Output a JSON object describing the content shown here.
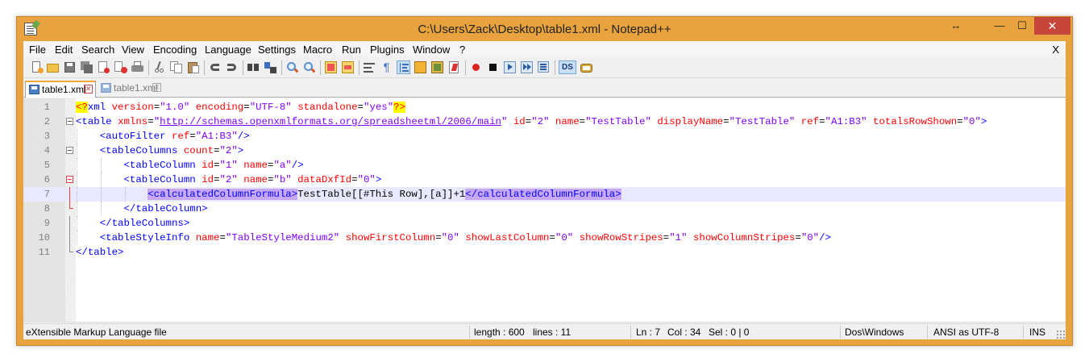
{
  "window": {
    "title": "C:\\Users\\Zack\\Desktop\\table1.xml - Notepad++",
    "resize_glyph": "↔",
    "minimize_glyph": "—",
    "maximize_glyph": "☐",
    "close_glyph": "✕"
  },
  "menu": {
    "items": [
      "File",
      "Edit",
      "Search",
      "View",
      "Encoding",
      "Language",
      "Settings",
      "Macro",
      "Run",
      "Plugins",
      "Window",
      "?"
    ],
    "close_label": "X"
  },
  "toolbar": {
    "icons": [
      "new-file-icon",
      "open-file-icon",
      "save-icon",
      "save-all-icon",
      "close-icon",
      "close-all-icon",
      "print-icon",
      "cut-icon",
      "copy-icon",
      "paste-icon",
      "undo-icon",
      "redo-icon",
      "find-icon",
      "replace-icon",
      "zoom-in-icon",
      "zoom-out-icon",
      "sync-vertical-icon",
      "sync-horizontal-icon",
      "word-wrap-icon",
      "show-all-chars-icon",
      "indent-guide-icon",
      "user-language-icon",
      "function-list-icon",
      "record-macro-icon",
      "stop-record-icon",
      "play-macro-icon",
      "run-macro-multiple-icon",
      "save-macro-icon",
      "document-switcher-icon",
      "plugin-icon"
    ],
    "ds_label": "DS"
  },
  "tabs": [
    {
      "label": "table1.xml",
      "active": true
    },
    {
      "label": "table1.xml",
      "active": false
    }
  ],
  "editor": {
    "current_line": 7,
    "lines": [
      {
        "n": "1",
        "parts": [
          [
            "pi",
            "<?"
          ],
          [
            "tag",
            "xml "
          ],
          [
            "attr",
            "version"
          ],
          [
            "text",
            "="
          ],
          [
            "val",
            "\"1.0\""
          ],
          [
            "text",
            " "
          ],
          [
            "attr",
            "encoding"
          ],
          [
            "text",
            "="
          ],
          [
            "val",
            "\"UTF-8\""
          ],
          [
            "text",
            " "
          ],
          [
            "attr",
            "standalone"
          ],
          [
            "text",
            "="
          ],
          [
            "val",
            "\"yes\""
          ],
          [
            "pi",
            "?>"
          ]
        ]
      },
      {
        "n": "2",
        "parts": [
          [
            "tag",
            "<table "
          ],
          [
            "attr",
            "xmlns"
          ],
          [
            "text",
            "="
          ],
          [
            "val",
            "\""
          ],
          [
            "link",
            "http://schemas.openxmlformats.org/spreadsheetml/2006/main"
          ],
          [
            "val",
            "\""
          ],
          [
            "text",
            " "
          ],
          [
            "attr",
            "id"
          ],
          [
            "text",
            "="
          ],
          [
            "val",
            "\"2\""
          ],
          [
            "text",
            " "
          ],
          [
            "attr",
            "name"
          ],
          [
            "text",
            "="
          ],
          [
            "val",
            "\"TestTable\""
          ],
          [
            "text",
            " "
          ],
          [
            "attr",
            "displayName"
          ],
          [
            "text",
            "="
          ],
          [
            "val",
            "\"TestTable\""
          ],
          [
            "text",
            " "
          ],
          [
            "attr",
            "ref"
          ],
          [
            "text",
            "="
          ],
          [
            "val",
            "\"A1:B3\""
          ],
          [
            "text",
            " "
          ],
          [
            "attr",
            "totalsRowShown"
          ],
          [
            "text",
            "="
          ],
          [
            "val",
            "\"0\""
          ],
          [
            "tag",
            ">"
          ]
        ]
      },
      {
        "n": "3",
        "parts": [
          [
            "text",
            "    "
          ],
          [
            "tag",
            "<autoFilter "
          ],
          [
            "attr",
            "ref"
          ],
          [
            "text",
            "="
          ],
          [
            "val",
            "\"A1:B3\""
          ],
          [
            "tag",
            "/>"
          ]
        ]
      },
      {
        "n": "4",
        "parts": [
          [
            "text",
            "    "
          ],
          [
            "tag",
            "<tableColumns "
          ],
          [
            "attr",
            "count"
          ],
          [
            "text",
            "="
          ],
          [
            "val",
            "\"2\""
          ],
          [
            "tag",
            ">"
          ]
        ]
      },
      {
        "n": "5",
        "parts": [
          [
            "text",
            "        "
          ],
          [
            "tag",
            "<tableColumn "
          ],
          [
            "attr",
            "id"
          ],
          [
            "text",
            "="
          ],
          [
            "val",
            "\"1\""
          ],
          [
            "text",
            " "
          ],
          [
            "attr",
            "name"
          ],
          [
            "text",
            "="
          ],
          [
            "val",
            "\"a\""
          ],
          [
            "tag",
            "/>"
          ]
        ]
      },
      {
        "n": "6",
        "parts": [
          [
            "text",
            "        "
          ],
          [
            "tag",
            "<tableColumn "
          ],
          [
            "attr",
            "id"
          ],
          [
            "text",
            "="
          ],
          [
            "val",
            "\"2\""
          ],
          [
            "text",
            " "
          ],
          [
            "attr",
            "name"
          ],
          [
            "text",
            "="
          ],
          [
            "val",
            "\"b\""
          ],
          [
            "text",
            " "
          ],
          [
            "attr",
            "dataDxfId"
          ],
          [
            "text",
            "="
          ],
          [
            "val",
            "\"0\""
          ],
          [
            "tag",
            ">"
          ]
        ]
      },
      {
        "n": "7",
        "parts": [
          [
            "text",
            "            "
          ],
          [
            "hltag",
            "<calculatedColumnFormula>"
          ],
          [
            "text",
            "TestTable[[#This Row],[a]]+1"
          ],
          [
            "hltag",
            "</calculatedColumnFormula>"
          ]
        ]
      },
      {
        "n": "8",
        "parts": [
          [
            "text",
            "        "
          ],
          [
            "tag",
            "</tableColumn>"
          ]
        ]
      },
      {
        "n": "9",
        "parts": [
          [
            "text",
            "    "
          ],
          [
            "tag",
            "</tableColumns>"
          ]
        ]
      },
      {
        "n": "10",
        "parts": [
          [
            "text",
            "    "
          ],
          [
            "tag",
            "<tableStyleInfo "
          ],
          [
            "attr",
            "name"
          ],
          [
            "text",
            "="
          ],
          [
            "val",
            "\"TableStyleMedium2\""
          ],
          [
            "text",
            " "
          ],
          [
            "attr",
            "showFirstColumn"
          ],
          [
            "text",
            "="
          ],
          [
            "val",
            "\"0\""
          ],
          [
            "text",
            " "
          ],
          [
            "attr",
            "showLastColumn"
          ],
          [
            "text",
            "="
          ],
          [
            "val",
            "\"0\""
          ],
          [
            "text",
            " "
          ],
          [
            "attr",
            "showRowStripes"
          ],
          [
            "text",
            "="
          ],
          [
            "val",
            "\"1\""
          ],
          [
            "text",
            " "
          ],
          [
            "attr",
            "showColumnStripes"
          ],
          [
            "text",
            "="
          ],
          [
            "val",
            "\"0\""
          ],
          [
            "tag",
            "/>"
          ]
        ]
      },
      {
        "n": "11",
        "parts": [
          [
            "tag",
            "</table>"
          ]
        ]
      }
    ]
  },
  "scrollbar": {
    "left_arrow": "<",
    "right_arrow": ">"
  },
  "status": {
    "file_type": "eXtensible Markup Language file",
    "length": "length : 600",
    "lines": "lines : 11",
    "ln": "Ln : 7",
    "col": "Col : 34",
    "sel": "Sel : 0 | 0",
    "eol": "Dos\\Windows",
    "encoding": "ANSI as UTF-8",
    "mode": "INS"
  },
  "colors": {
    "title_bar": "#e8a33f",
    "close_button": "#c7463b",
    "tag": "#0000ff",
    "attribute": "#ff0000",
    "value": "#8000ff",
    "current_line": "#e8e8ff",
    "matched_tag_highlight": "#c6a8f5"
  }
}
